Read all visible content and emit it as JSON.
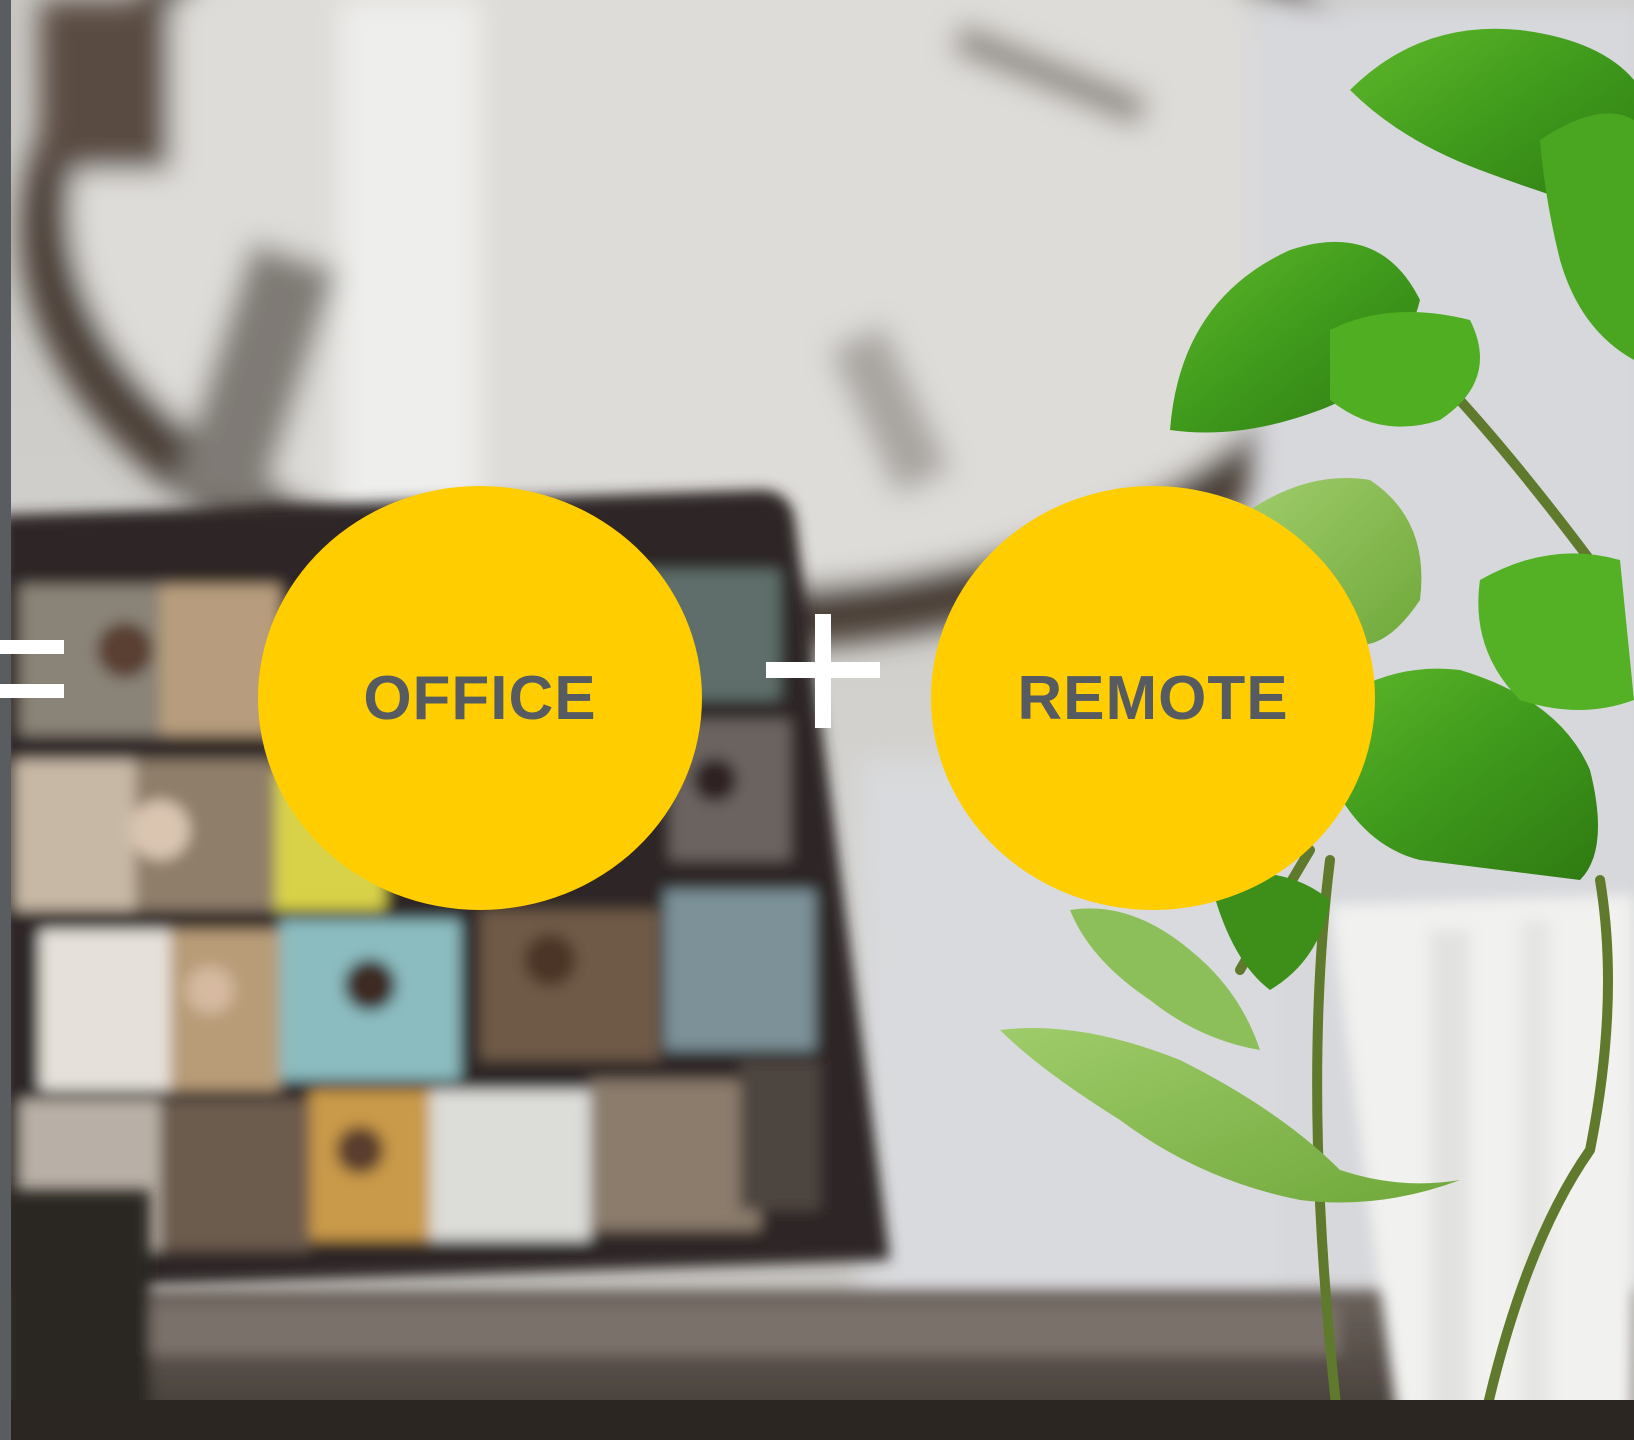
{
  "operators": {
    "equals": "equals-sign",
    "plus": "plus-sign"
  },
  "circles": {
    "office_label": "OFFICE",
    "remote_label": "REMOTE"
  },
  "colors": {
    "circle_fill": "#ffcd00",
    "circle_text": "#555b60",
    "operator": "#ffffff",
    "left_edge": "#5a5d60"
  },
  "background": {
    "scene": "blurred-video-call-laptop-and-plant-photo"
  }
}
